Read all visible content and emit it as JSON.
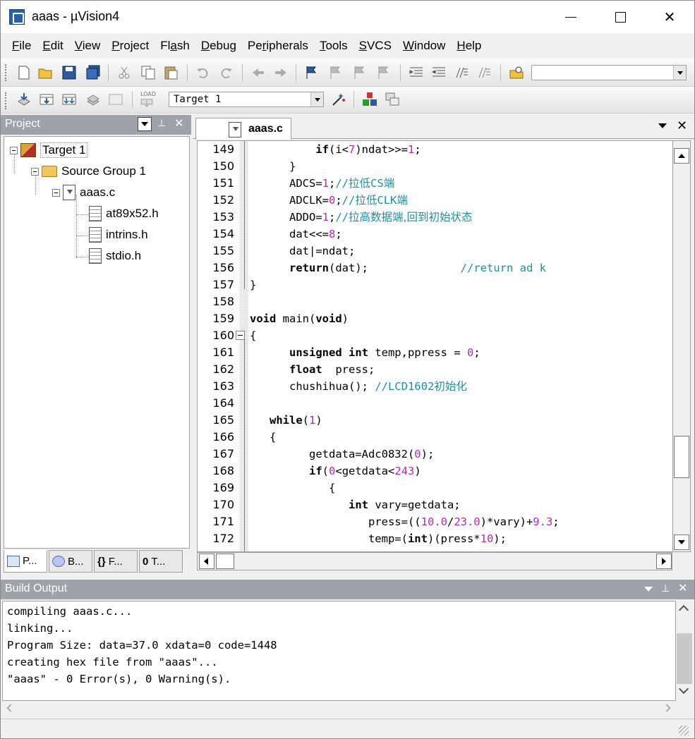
{
  "window": {
    "title": "aaas  - µVision4"
  },
  "menu": [
    {
      "u": "F",
      "rest": "ile"
    },
    {
      "u": "E",
      "rest": "dit"
    },
    {
      "u": "V",
      "rest": "iew"
    },
    {
      "u": "P",
      "rest": "roject"
    },
    {
      "pre": "Fl",
      "u": "a",
      "rest": "sh"
    },
    {
      "u": "D",
      "rest": "ebug"
    },
    {
      "pre": "Pe",
      "u": "r",
      "rest": "ipherals"
    },
    {
      "u": "T",
      "rest": "ools"
    },
    {
      "u": "S",
      "rest": "VCS"
    },
    {
      "u": "W",
      "rest": "indow"
    },
    {
      "u": "H",
      "rest": "elp"
    }
  ],
  "toolbar2": {
    "target_combo": "Target 1",
    "load_label": "LOAD"
  },
  "project": {
    "header": "Project",
    "tree": {
      "target": "Target 1",
      "group": "Source Group 1",
      "file": "aaas.c",
      "includes": [
        "at89x52.h",
        "intrins.h",
        "stdio.h"
      ]
    },
    "tabs": [
      "P...",
      "B...",
      "F...",
      "T..."
    ],
    "tab_glyphs": [
      "",
      "",
      "{}",
      "0"
    ]
  },
  "editor": {
    "tab": "aaas.c",
    "lines": [
      {
        "n": "149",
        "html": "          <span class=\"kw\">if</span>(i&lt;<span class=\"num\">7</span>)ndat&gt;&gt;=<span class=\"num\">1</span>;"
      },
      {
        "n": "150",
        "html": "      }"
      },
      {
        "n": "151",
        "html": "      ADCS=<span class=\"num\">1</span>;<span class=\"cm\">//<span class=\"cn\">拉低</span>CS<span class=\"cn\">端</span></span>"
      },
      {
        "n": "152",
        "html": "      ADCLK=<span class=\"num\">0</span>;<span class=\"cm\">//<span class=\"cn\">拉低</span>CLK<span class=\"cn\">端</span></span>"
      },
      {
        "n": "153",
        "html": "      ADDO=<span class=\"num\">1</span>;<span class=\"cm\">//<span class=\"cn\">拉高数据端,回到初始状态</span></span>"
      },
      {
        "n": "154",
        "html": "      dat&lt;&lt;=<span class=\"num\">8</span>;"
      },
      {
        "n": "155",
        "html": "      dat|=ndat;"
      },
      {
        "n": "156",
        "html": "      <span class=\"kw\">return</span>(dat);              <span class=\"cm\">//return ad k</span>"
      },
      {
        "n": "157",
        "html": "}"
      },
      {
        "n": "158",
        "html": ""
      },
      {
        "n": "159",
        "html": "<span class=\"kw\">void</span> main(<span class=\"kw\">void</span>)"
      },
      {
        "n": "160",
        "html": "{"
      },
      {
        "n": "161",
        "html": "      <span class=\"kw\">unsigned int</span> temp,ppress = <span class=\"num\">0</span>;"
      },
      {
        "n": "162",
        "html": "      <span class=\"kw\">float</span>  press;"
      },
      {
        "n": "163",
        "html": "      chushihua(); <span class=\"cm\">//LCD1602<span class=\"cn\">初始化</span></span>"
      },
      {
        "n": "164",
        "html": ""
      },
      {
        "n": "165",
        "html": "   <span class=\"kw\">while</span>(<span class=\"num\">1</span>)"
      },
      {
        "n": "166",
        "html": "   {"
      },
      {
        "n": "167",
        "html": "         getdata=Adc0832(<span class=\"num\">0</span>);"
      },
      {
        "n": "168",
        "html": "         <span class=\"kw\">if</span>(<span class=\"num\">0</span>&lt;getdata&lt;<span class=\"num\">243</span>)"
      },
      {
        "n": "169",
        "html": "            {"
      },
      {
        "n": "170",
        "html": "               <span class=\"kw\">int</span> vary=getdata;"
      },
      {
        "n": "171",
        "html": "                  press=((<span class=\"num\">10.0</span>/<span class=\"num\">23.0</span>)*vary)+<span class=\"num\">9.3</span>;"
      },
      {
        "n": "172",
        "html": "                  temp=(<span class=\"kw\">int</span>)(press*<span class=\"num\">10</span>);"
      }
    ]
  },
  "build": {
    "header": "Build Output",
    "lines": [
      "compiling aaas.c...",
      "linking...",
      "Program Size: data=37.0 xdata=0 code=1448",
      "creating hex file from \"aaas\"...",
      "\"aaas\" - 0 Error(s), 0 Warning(s)."
    ]
  }
}
